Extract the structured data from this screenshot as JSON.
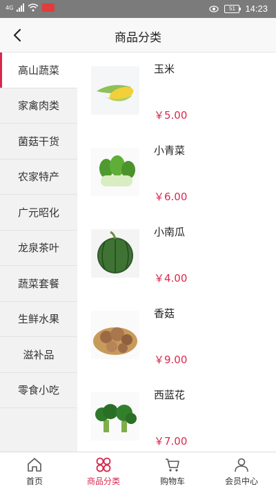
{
  "status_bar": {
    "network": "4G",
    "time": "14:23",
    "battery": "51"
  },
  "header": {
    "title": "商品分类"
  },
  "sidebar": {
    "items": [
      {
        "label": "高山蔬菜",
        "active": true
      },
      {
        "label": "家禽肉类"
      },
      {
        "label": "菌菇干货"
      },
      {
        "label": "农家特产"
      },
      {
        "label": "广元昭化"
      },
      {
        "label": "龙泉茶叶"
      },
      {
        "label": "蔬菜套餐"
      },
      {
        "label": "生鲜水果"
      },
      {
        "label": "滋补品"
      },
      {
        "label": "零食小吃"
      }
    ]
  },
  "products": [
    {
      "name": "玉米",
      "price": "￥5.00",
      "icon": "corn-image"
    },
    {
      "name": "小青菜",
      "price": "￥6.00",
      "icon": "bok-choy-image"
    },
    {
      "name": "小南瓜",
      "price": "￥4.00",
      "icon": "pumpkin-image"
    },
    {
      "name": "香菇",
      "price": "￥9.00",
      "icon": "mushroom-image"
    },
    {
      "name": "西蓝花",
      "price": "￥7.00",
      "icon": "broccoli-image"
    }
  ],
  "bottom_nav": {
    "items": [
      {
        "label": "首页",
        "icon": "home-icon"
      },
      {
        "label": "商品分类",
        "icon": "category-icon",
        "active": true
      },
      {
        "label": "购物车",
        "icon": "cart-icon"
      },
      {
        "label": "会员中心",
        "icon": "user-icon"
      }
    ]
  },
  "colors": {
    "accent": "#d8284d",
    "sidebar_bg": "#f2f2f2",
    "status_bar": "#7b7b7b"
  }
}
